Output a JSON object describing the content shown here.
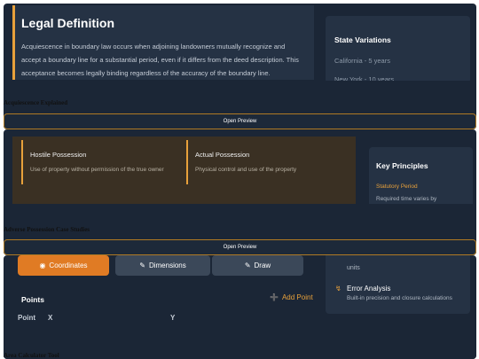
{
  "cards": [
    {
      "caption": "Acquiescence Explained",
      "button_label": "Open Preview",
      "main": {
        "title": "Legal Definition",
        "body": "Acquiescence in boundary law occurs when adjoining landowners mutually recognize and accept a boundary line for a substantial period, even if it differs from the deed description. This acceptance becomes legally binding regardless of the accuracy of the boundary line."
      },
      "side": {
        "title": "State Variations",
        "items": [
          "California - 5 years",
          "New York - 10 years"
        ]
      }
    },
    {
      "caption": "Adverse Possession Case Studies",
      "button_label": "Open Preview",
      "columns": [
        {
          "heading": "Hostile Possession",
          "text": "Use of property without permission of the true owner"
        },
        {
          "heading": "Actual Possession",
          "text": "Physical control and use of the property"
        }
      ],
      "side": {
        "title": "Key Principles",
        "subtitle": "Statutory Period",
        "text": "Required time varies by"
      }
    },
    {
      "caption": "Area Calculator Tool",
      "tabs": [
        "Coordinates",
        "Dimensions",
        "Draw"
      ],
      "points_label": "Points",
      "add_point_label": "Add Point",
      "table_headers": [
        "Point",
        "X",
        "Y"
      ],
      "side": {
        "units_text": "units",
        "title": "Error Analysis",
        "text": "Built-in precision and closure calculations"
      }
    }
  ],
  "colors": {
    "accent": "#e8a13b",
    "card_bg": "#1b2636",
    "panel_bg": "#253244"
  }
}
